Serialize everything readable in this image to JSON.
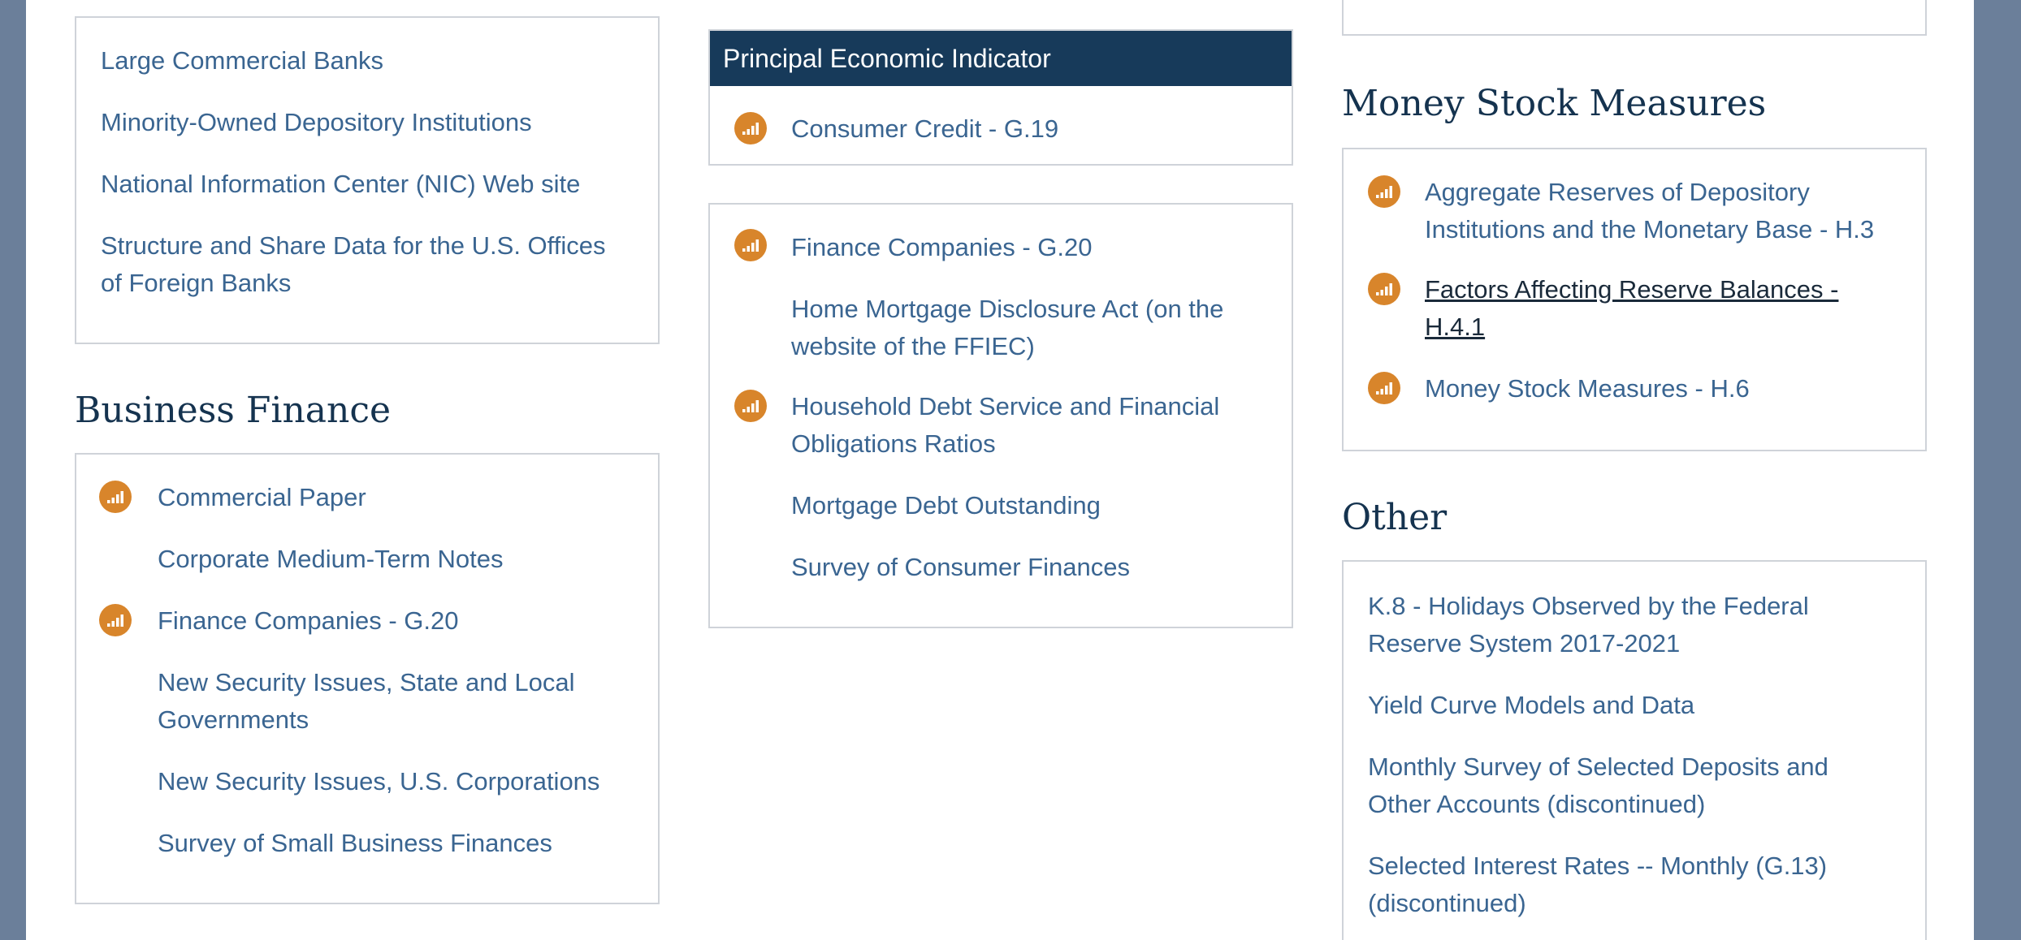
{
  "left_column": {
    "top_box_links": [
      "Large Commercial Banks",
      "Minority-Owned Depository Institutions",
      "National Information Center (NIC) Web site",
      "Structure and Share Data for the U.S. Offices",
      "of Foreign Banks"
    ],
    "business_finance": {
      "heading": "Business Finance",
      "links": [
        "Commercial Paper",
        "Corporate Medium-Term Notes",
        "Finance Companies - G.20",
        "New Security Issues, State and Local",
        "Governments",
        "New Security Issues, U.S. Corporations",
        "Survey of Small Business Finances"
      ]
    }
  },
  "middle_column": {
    "principal_box": {
      "title": "Principal Economic Indicator",
      "links": [
        "Consumer Credit - G.19"
      ]
    },
    "household_box": {
      "links": [
        "Finance Companies - G.20",
        "Home Mortgage Disclosure Act (on the",
        "website of the FFIEC)",
        "Household Debt Service and Financial",
        "Obligations Ratios",
        "Mortgage Debt Outstanding",
        "Survey of Consumer Finances"
      ]
    }
  },
  "right_column": {
    "money_stock": {
      "heading": "Money Stock Measures",
      "links": [
        "Aggregate Reserves of Depository",
        "Institutions and the Monetary Base - H.3",
        "Factors Affecting Reserve Balances -",
        "H.4.1",
        "Money Stock Measures - H.6"
      ]
    },
    "other": {
      "heading": "Other",
      "links": [
        "K.8 - Holidays Observed by the Federal",
        "Reserve System 2017-2021",
        "Yield Curve Models and Data",
        "Monthly Survey of Selected Deposits and",
        "Other Accounts (discontinued)",
        "Selected Interest Rates -- Monthly (G.13)",
        "(discontinued)"
      ]
    }
  },
  "icon": {
    "name": "data-chart-icon",
    "color": "#d8852b"
  }
}
